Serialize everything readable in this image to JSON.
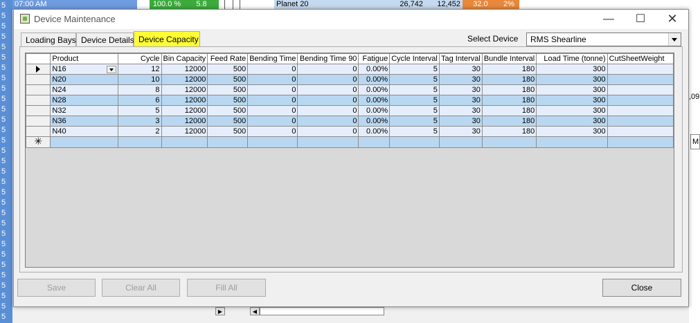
{
  "background": {
    "row_numbers": [
      "5",
      "5",
      "5",
      "5",
      "5",
      "5",
      "5",
      "5",
      "5",
      "5",
      "5",
      "5",
      "5",
      "5",
      "5",
      "5",
      "5",
      "5",
      "5",
      "5",
      "5",
      "5",
      "5",
      "5",
      "5",
      "5",
      "5",
      "5",
      "5",
      "5",
      "5"
    ],
    "top_row": {
      "time": "07:00 AM",
      "percent": "100.0 %",
      "value": "5.8",
      "name": "Planet 20",
      "num1": "26,742",
      "num2": "12,452",
      "num3": "32.0",
      "num4": "2%"
    },
    "right_text": ",09",
    "right_box": "M"
  },
  "dialog": {
    "title": "Device Maintenance",
    "minimize_glyph": "—",
    "maximize_glyph": "☐",
    "close_glyph": "✕",
    "tabs": [
      {
        "label": "Loading Bays"
      },
      {
        "label": "Device Details"
      },
      {
        "label": "Device Capacity"
      }
    ],
    "select_device_label": "Select Device",
    "select_device_value": "RMS Shearline",
    "grid": {
      "columns": [
        "Product",
        "Cycle",
        "Bin Capacity",
        "Feed Rate",
        "Bending Time",
        "Bending Time 90",
        "Fatigue",
        "Cycle Interval",
        "Tag Interval",
        "Bundle Interval",
        "Load Time (tonne)",
        "CutSheetWeight"
      ],
      "rows": [
        [
          "N16",
          "12",
          "12000",
          "500",
          "0",
          "0",
          "0.00%",
          "5",
          "30",
          "180",
          "300",
          ""
        ],
        [
          "N20",
          "10",
          "12000",
          "500",
          "0",
          "0",
          "0.00%",
          "5",
          "30",
          "180",
          "300",
          ""
        ],
        [
          "N24",
          "8",
          "12000",
          "500",
          "0",
          "0",
          "0.00%",
          "5",
          "30",
          "180",
          "300",
          ""
        ],
        [
          "N28",
          "6",
          "12000",
          "500",
          "0",
          "0",
          "0.00%",
          "5",
          "30",
          "180",
          "300",
          ""
        ],
        [
          "N32",
          "5",
          "12000",
          "500",
          "0",
          "0",
          "0.00%",
          "5",
          "30",
          "180",
          "300",
          ""
        ],
        [
          "N36",
          "3",
          "12000",
          "500",
          "0",
          "0",
          "0.00%",
          "5",
          "30",
          "180",
          "300",
          ""
        ],
        [
          "N40",
          "2",
          "12000",
          "500",
          "0",
          "0",
          "0.00%",
          "5",
          "30",
          "180",
          "300",
          ""
        ]
      ],
      "new_row_glyph": "✳"
    },
    "buttons": {
      "save": "Save",
      "clear_all": "Clear All",
      "fill_all": "Fill All",
      "close": "Close"
    }
  }
}
